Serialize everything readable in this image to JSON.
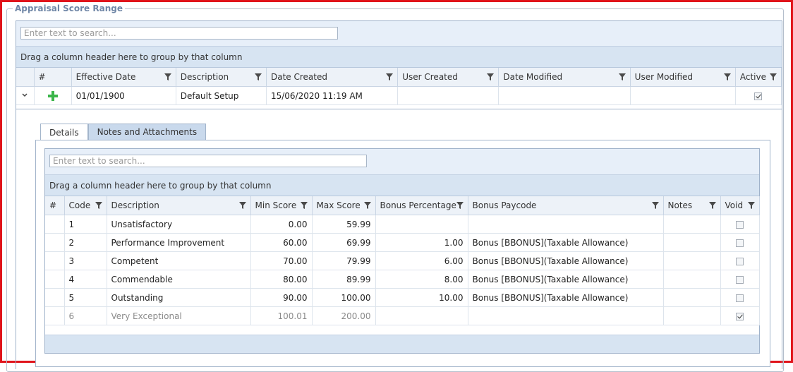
{
  "section": {
    "title": "Appraisal Score Range"
  },
  "outer_grid": {
    "search_placeholder": "Enter text to search...",
    "group_hint": "Drag a column header here to group by that column",
    "columns": [
      "#",
      "Effective Date",
      "Description",
      "Date Created",
      "User Created",
      "Date Modified",
      "User Modified",
      "Active"
    ],
    "row": {
      "effective_date": "01/01/1900",
      "description": "Default Setup",
      "date_created": "15/06/2020 11:19 AM",
      "user_created": "",
      "date_modified": "",
      "user_modified": "",
      "active": true
    }
  },
  "tabs": [
    {
      "label": "Details",
      "active": true
    },
    {
      "label": "Notes and Attachments",
      "active": false
    }
  ],
  "inner_grid": {
    "search_placeholder": "Enter text to search...",
    "group_hint": "Drag a column header here to group by that column",
    "columns": [
      "#",
      "Code",
      "Description",
      "Min Score",
      "Max Score",
      "Bonus Percentage",
      "Bonus Paycode",
      "Notes",
      "Void"
    ],
    "rows": [
      {
        "code": "1",
        "description": "Unsatisfactory",
        "min": "0.00",
        "max": "59.99",
        "bonus_pct": "",
        "paycode": "",
        "notes": "",
        "void": false
      },
      {
        "code": "2",
        "description": "Performance Improvement",
        "min": "60.00",
        "max": "69.99",
        "bonus_pct": "1.00",
        "paycode": "Bonus [BBONUS](Taxable Allowance)",
        "notes": "",
        "void": false
      },
      {
        "code": "3",
        "description": "Competent",
        "min": "70.00",
        "max": "79.99",
        "bonus_pct": "6.00",
        "paycode": "Bonus [BBONUS](Taxable Allowance)",
        "notes": "",
        "void": false
      },
      {
        "code": "4",
        "description": "Commendable",
        "min": "80.00",
        "max": "89.99",
        "bonus_pct": "8.00",
        "paycode": "Bonus [BBONUS](Taxable Allowance)",
        "notes": "",
        "void": false
      },
      {
        "code": "5",
        "description": "Outstanding",
        "min": "90.00",
        "max": "100.00",
        "bonus_pct": "10.00",
        "paycode": "Bonus [BBONUS](Taxable Allowance)",
        "notes": "",
        "void": false
      },
      {
        "code": "6",
        "description": "Very Exceptional",
        "min": "100.01",
        "max": "200.00",
        "bonus_pct": "",
        "paycode": "",
        "notes": "",
        "void": true
      }
    ]
  },
  "colors": {
    "border": "#e0141b",
    "header_bg": "#edf2f8",
    "group_panel": "#d7e4f2",
    "tab_inactive": "#c9d9ec",
    "plus": "#3bb54a"
  },
  "icons": {
    "expand": "chevron-down-icon",
    "add": "plus-icon",
    "filter": "filter-icon"
  }
}
